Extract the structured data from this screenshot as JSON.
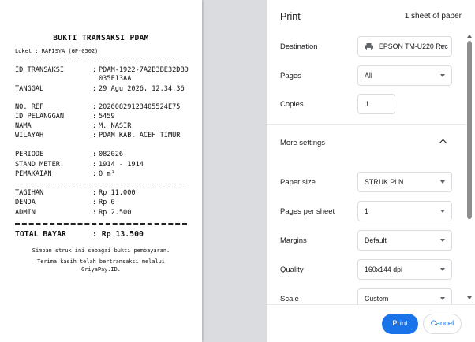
{
  "receipt": {
    "title": "BUKTI TRANSAKSI PDAM",
    "loket": "Loket : RAFISYA (GP-0502)",
    "rows": [
      {
        "label": "ID TRANSAKSI",
        "value": "PDAM-1922-7A2B3BE32DBD035F13AA"
      },
      {
        "label": "TANGGAL",
        "value": "29 Agu 2026, 12.34.36"
      },
      {
        "label": "NO. REF",
        "value": "20260829123405524E75"
      },
      {
        "label": "ID PELANGGAN",
        "value": "5459"
      },
      {
        "label": "NAMA",
        "value": "M. NASIR"
      },
      {
        "label": "WILAYAH",
        "value": "PDAM KAB. ACEH TIMUR"
      },
      {
        "label": "PERIODE",
        "value": "082026"
      },
      {
        "label": "STAND METER",
        "value": "1914 - 1914"
      },
      {
        "label": "PEMAKAIAN",
        "value": "0 m³"
      }
    ],
    "charges": [
      {
        "label": "TAGIHAN",
        "value": "Rp 11.000"
      },
      {
        "label": "DENDA",
        "value": "Rp 0"
      },
      {
        "label": "ADMIN",
        "value": "Rp 2.500"
      }
    ],
    "separator": ":",
    "total_label": "TOTAL BAYAR",
    "total_value": ": Rp 13.500",
    "footer_line1": "Simpan struk ini sebagai bukti pembayaran.",
    "footer_line2": "Terima kasih telah bertransaksi melalui",
    "footer_line3": "GriyaPay.ID."
  },
  "panel": {
    "title": "Print",
    "sheet_count": "1 sheet of paper",
    "destination_label": "Destination",
    "destination_value": "EPSON TM-U220 Rec",
    "destination_icon": "printer-icon",
    "pages_label": "Pages",
    "pages_value": "All",
    "copies_label": "Copies",
    "copies_value": "1",
    "more_settings_label": "More settings",
    "paper_size_label": "Paper size",
    "paper_size_value": "STRUK PLN",
    "pages_per_sheet_label": "Pages per sheet",
    "pages_per_sheet_value": "1",
    "margins_label": "Margins",
    "margins_value": "Default",
    "quality_label": "Quality",
    "quality_value": "160x144 dpi",
    "scale_label": "Scale",
    "scale_value": "Custom"
  },
  "buttons": {
    "print": "Print",
    "cancel": "Cancel"
  },
  "colors": {
    "accent": "#1a73e8",
    "preview_bg": "#dadce0"
  }
}
